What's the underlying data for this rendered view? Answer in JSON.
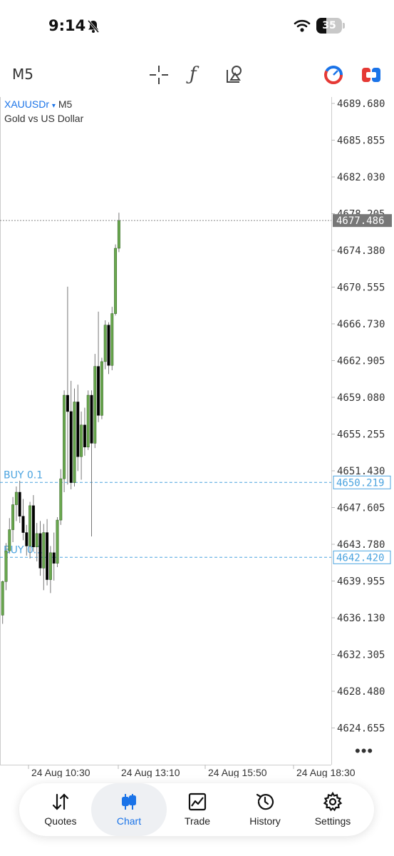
{
  "status_bar": {
    "time": "9:14",
    "battery": "35",
    "icons": [
      "bell-slash-icon",
      "wifi-icon",
      "battery-icon"
    ]
  },
  "toolbar": {
    "timeframe": "M5",
    "tools": [
      "crosshair-icon",
      "function-icon",
      "objects-icon"
    ],
    "right_icons": [
      "one-click-trading-icon",
      "trade-panel-icon"
    ]
  },
  "chart": {
    "symbol": "XAUUSDr",
    "symbol_arrow": "▾",
    "period": "M5",
    "description": "Gold vs US Dollar",
    "price_labels": [
      "4689.680",
      "4685.855",
      "4682.030",
      "4678.205",
      "4674.380",
      "4670.555",
      "4666.730",
      "4662.905",
      "4659.080",
      "4655.255",
      "4651.430",
      "4647.605",
      "4643.780",
      "4639.955",
      "4636.130",
      "4632.305",
      "4628.480",
      "4624.655"
    ],
    "time_labels": [
      "24 Aug 10:30",
      "24 Aug 13:10",
      "24 Aug 15:50",
      "24 Aug 18:30"
    ],
    "current_price": "4677.486",
    "orders": [
      {
        "label": "BUY 0.1",
        "price": "4650.219"
      },
      {
        "label": "BUY 0.1",
        "price": "4642.420"
      }
    ],
    "more_icon": "more-dots-icon",
    "colors": {
      "bull_body": "#6aa84f",
      "bear_body": "#000000",
      "wick": "#777777",
      "order_line": "#4aa3df",
      "axis": "#cccccc"
    }
  },
  "chart_data": {
    "type": "candlestick",
    "symbol": "XAUUSDr",
    "ylim": [
      4622.0,
      4691.0
    ],
    "candles": [
      {
        "o": 4636.4,
        "h": 4640.0,
        "l": 4635.5,
        "c": 4639.9
      },
      {
        "o": 4639.9,
        "h": 4643.9,
        "l": 4639.0,
        "c": 4643.1
      },
      {
        "o": 4643.1,
        "h": 4646.5,
        "l": 4642.8,
        "c": 4645.3
      },
      {
        "o": 4645.3,
        "h": 4648.7,
        "l": 4644.0,
        "c": 4647.9
      },
      {
        "o": 4647.9,
        "h": 4649.8,
        "l": 4646.2,
        "c": 4649.2
      },
      {
        "o": 4649.2,
        "h": 4650.4,
        "l": 4646.0,
        "c": 4646.7
      },
      {
        "o": 4646.7,
        "h": 4648.5,
        "l": 4644.2,
        "c": 4645.0
      },
      {
        "o": 4645.0,
        "h": 4645.8,
        "l": 4642.6,
        "c": 4643.6
      },
      {
        "o": 4643.6,
        "h": 4648.2,
        "l": 4642.3,
        "c": 4647.8
      },
      {
        "o": 4647.8,
        "h": 4648.9,
        "l": 4643.0,
        "c": 4643.5
      },
      {
        "o": 4643.5,
        "h": 4646.0,
        "l": 4642.0,
        "c": 4644.9
      },
      {
        "o": 4644.9,
        "h": 4646.2,
        "l": 4640.5,
        "c": 4641.3
      },
      {
        "o": 4641.3,
        "h": 4645.9,
        "l": 4639.0,
        "c": 4645.0
      },
      {
        "o": 4645.0,
        "h": 4646.4,
        "l": 4639.5,
        "c": 4640.1
      },
      {
        "o": 4640.1,
        "h": 4643.6,
        "l": 4638.7,
        "c": 4642.9
      },
      {
        "o": 4642.9,
        "h": 4645.0,
        "l": 4640.0,
        "c": 4641.8
      },
      {
        "o": 4641.8,
        "h": 4646.6,
        "l": 4641.4,
        "c": 4646.3
      },
      {
        "o": 4646.3,
        "h": 4651.6,
        "l": 4645.8,
        "c": 4650.6
      },
      {
        "o": 4650.6,
        "h": 4659.8,
        "l": 4649.2,
        "c": 4659.3
      },
      {
        "o": 4659.3,
        "h": 4670.6,
        "l": 4650.0,
        "c": 4657.6
      },
      {
        "o": 4657.6,
        "h": 4660.8,
        "l": 4649.5,
        "c": 4650.2
      },
      {
        "o": 4650.2,
        "h": 4660.0,
        "l": 4649.8,
        "c": 4658.6
      },
      {
        "o": 4658.6,
        "h": 4660.4,
        "l": 4651.4,
        "c": 4652.9
      },
      {
        "o": 4652.9,
        "h": 4657.6,
        "l": 4650.5,
        "c": 4656.2
      },
      {
        "o": 4656.2,
        "h": 4658.0,
        "l": 4653.0,
        "c": 4653.9
      },
      {
        "o": 4653.9,
        "h": 4659.8,
        "l": 4653.6,
        "c": 4659.3
      },
      {
        "o": 4659.3,
        "h": 4659.8,
        "l": 4644.6,
        "c": 4654.3
      },
      {
        "o": 4654.3,
        "h": 4663.6,
        "l": 4653.8,
        "c": 4662.3
      },
      {
        "o": 4662.3,
        "h": 4668.0,
        "l": 4656.5,
        "c": 4657.2
      },
      {
        "o": 4657.2,
        "h": 4663.2,
        "l": 4656.8,
        "c": 4662.8
      },
      {
        "o": 4662.8,
        "h": 4667.1,
        "l": 4662.0,
        "c": 4666.6
      },
      {
        "o": 4666.6,
        "h": 4666.9,
        "l": 4661.5,
        "c": 4662.4
      },
      {
        "o": 4662.4,
        "h": 4668.5,
        "l": 4661.9,
        "c": 4667.8
      },
      {
        "o": 4667.8,
        "h": 4675.0,
        "l": 4667.6,
        "c": 4674.6
      },
      {
        "o": 4674.6,
        "h": 4678.3,
        "l": 4674.2,
        "c": 4677.5
      }
    ],
    "last_price": 4677.486,
    "order_prices": [
      4650.219,
      4642.42
    ]
  }
}
